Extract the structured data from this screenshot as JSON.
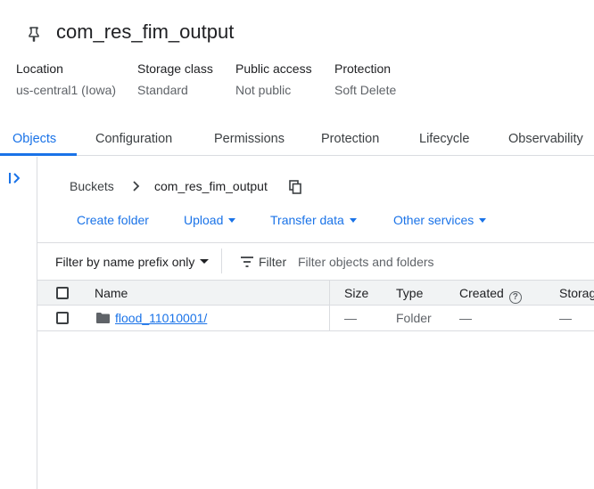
{
  "header": {
    "title": "com_res_fim_output",
    "pin_icon": "pin-icon"
  },
  "meta": [
    {
      "label": "Location",
      "value": "us-central1 (Iowa)"
    },
    {
      "label": "Storage class",
      "value": "Standard"
    },
    {
      "label": "Public access",
      "value": "Not public"
    },
    {
      "label": "Protection",
      "value": "Soft Delete"
    }
  ],
  "tabs": [
    {
      "label": "Objects",
      "active": true
    },
    {
      "label": "Configuration",
      "active": false
    },
    {
      "label": "Permissions",
      "active": false
    },
    {
      "label": "Protection",
      "active": false
    },
    {
      "label": "Lifecycle",
      "active": false
    },
    {
      "label": "Observability",
      "active": false
    }
  ],
  "breadcrumb": {
    "root": "Buckets",
    "current": "com_res_fim_output"
  },
  "actions": {
    "create_folder": "Create folder",
    "upload": "Upload",
    "transfer_data": "Transfer data",
    "other_services": "Other services"
  },
  "filter": {
    "prefix_mode": "Filter by name prefix only",
    "label": "Filter",
    "placeholder": "Filter objects and folders"
  },
  "table": {
    "columns": {
      "name": "Name",
      "size": "Size",
      "type": "Type",
      "created": "Created",
      "storage": "Storag"
    },
    "rows": [
      {
        "name": "flood_11010001/",
        "size": "—",
        "type": "Folder",
        "created": "—",
        "storage": "—"
      }
    ]
  },
  "colors": {
    "accent": "#1a73e8",
    "text": "#202124",
    "muted": "#5f6368",
    "border": "#dadce0",
    "header_bg": "#f1f3f4"
  }
}
